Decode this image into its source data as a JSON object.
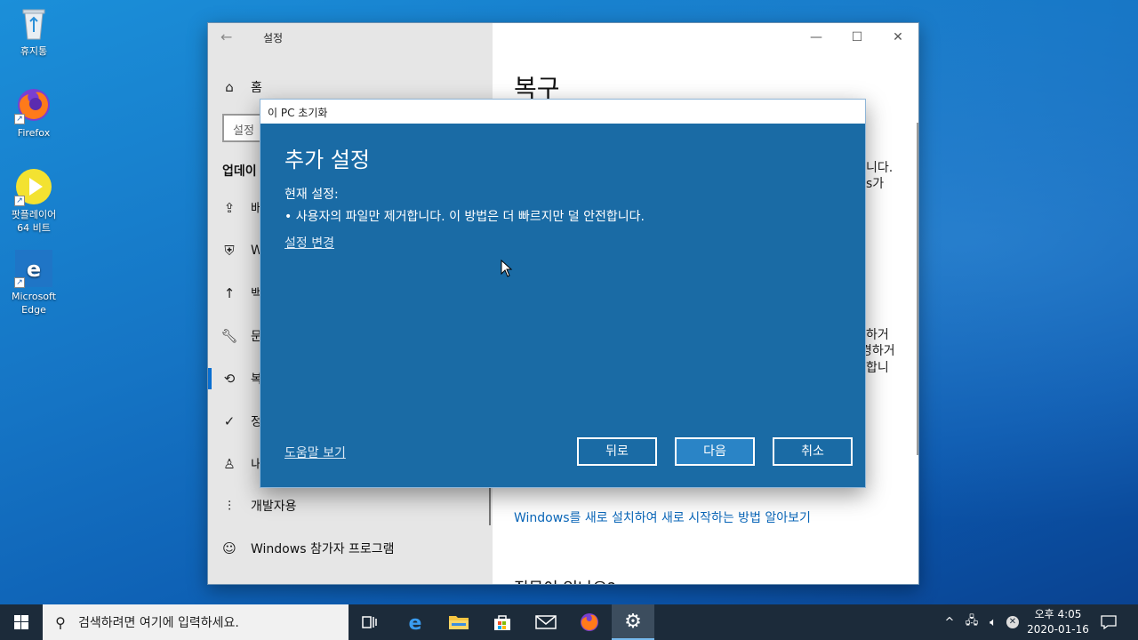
{
  "desktop": {
    "icons": [
      {
        "label": "휴지통"
      },
      {
        "label": "Firefox"
      },
      {
        "label": "팟플레이어 64 비트"
      },
      {
        "label": "Microsoft Edge"
      }
    ]
  },
  "settings": {
    "title": "설정",
    "home_label": "홈",
    "search_placeholder": "설정",
    "section_heading": "업데이",
    "nav_items": [
      {
        "label": "배"
      },
      {
        "label": "W"
      },
      {
        "label": "백"
      },
      {
        "label": "문"
      },
      {
        "label": "복"
      },
      {
        "label": "정"
      },
      {
        "label": "내"
      },
      {
        "label": "개발자용"
      },
      {
        "label": "Windows 참가자 프로그램"
      }
    ],
    "page_heading": "복구",
    "partial_lines": [
      "니다.",
      "s가",
      "하거",
      "경하거",
      "합니"
    ],
    "reinstall_link": "Windows를 새로 설치하여 새로 시작하는 방법 알아보기",
    "bottom_partial": "질문이 있나요?"
  },
  "dialog": {
    "title": "이 PC 초기화",
    "heading": "추가 설정",
    "current_label": "현재 설정:",
    "bullet": "•  사용자의 파일만 제거합니다. 이 방법은 더 빠르지만 덜 안전합니다.",
    "change_link": "설정 변경",
    "help_link": "도움말 보기",
    "back_button": "뒤로",
    "next_button": "다음",
    "cancel_button": "취소"
  },
  "taskbar": {
    "search_placeholder": "검색하려면 여기에 입력하세요.",
    "time": "오후 4:05",
    "date": "2020-01-16"
  },
  "colors": {
    "dialog_bg": "#1a6ba5",
    "accent": "#0a6fd1",
    "taskbar_bg": "#1c2b3a"
  }
}
